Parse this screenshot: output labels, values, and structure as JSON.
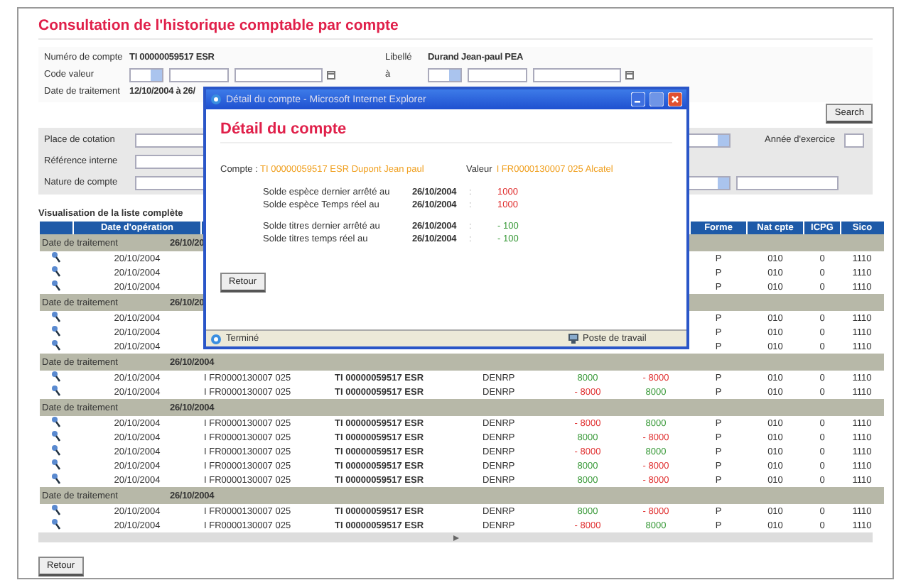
{
  "page_title": "Consultation de l'historique comptable par compte",
  "form": {
    "account_label": "Numéro de compte",
    "account_value": "TI 00000059517 ESR",
    "libelle_label": "Libellé",
    "libelle_value": "Durand Jean-paul PEA",
    "code_label": "Code valeur",
    "to_label": "à",
    "date_label": "Date de traitement",
    "date_value": "12/10/2004 à 26/"
  },
  "search_button": "Search",
  "filters": {
    "place_label": "Place de cotation",
    "ref_label": "Référence interne",
    "nature_label": "Nature de compte",
    "year_label": "Année d'exercice"
  },
  "list_caption": "Visualisation de la liste complète",
  "table": {
    "columns": {
      "date": "Date d'opération",
      "forme": "Forme",
      "nat": "Nat cpte",
      "icpg": "ICPG",
      "sico": "Sico"
    },
    "rows": [
      {
        "kind": "group",
        "label": "Date de traitement",
        "date": "26/10/20"
      },
      {
        "kind": "entry",
        "date": "20/10/2004",
        "forme": "P",
        "nat": "010",
        "icpg": "0",
        "sico": "1110"
      },
      {
        "kind": "entry",
        "date": "20/10/2004",
        "forme": "P",
        "nat": "010",
        "icpg": "0",
        "sico": "1110"
      },
      {
        "kind": "entry",
        "date": "20/10/2004",
        "forme": "P",
        "nat": "010",
        "icpg": "0",
        "sico": "1110"
      },
      {
        "kind": "group",
        "label": "Date de traitement",
        "date": "26/10/20"
      },
      {
        "kind": "entry",
        "date": "20/10/2004",
        "forme": "P",
        "nat": "010",
        "icpg": "0",
        "sico": "1110"
      },
      {
        "kind": "entry",
        "date": "20/10/2004",
        "forme": "P",
        "nat": "010",
        "icpg": "0",
        "sico": "1110"
      },
      {
        "kind": "entry",
        "date": "20/10/2004",
        "forme": "P",
        "nat": "010",
        "icpg": "0",
        "sico": "1110"
      },
      {
        "kind": "group",
        "label": "Date de traitement",
        "date": "26/10/2004"
      },
      {
        "kind": "entry",
        "date": "20/10/2004",
        "isin": "I FR0000130007 025",
        "account": "TI 00000059517 ESR",
        "operation": "DENRP",
        "amount_1": {
          "text": "8000",
          "color": "#3a9a3a"
        },
        "amount_2": {
          "text": "- 8000",
          "color": "#e03030"
        },
        "forme": "P",
        "nat": "010",
        "icpg": "0",
        "sico": "1110"
      },
      {
        "kind": "entry",
        "date": "20/10/2004",
        "isin": "I FR0000130007 025",
        "account": "TI 00000059517 ESR",
        "operation": "DENRP",
        "amount_1": {
          "text": "- 8000",
          "color": "#e03030"
        },
        "amount_2": {
          "text": "8000",
          "color": "#3a9a3a"
        },
        "forme": "P",
        "nat": "010",
        "icpg": "0",
        "sico": "1110"
      },
      {
        "kind": "group",
        "label": "Date de traitement",
        "date": "26/10/2004"
      },
      {
        "kind": "entry",
        "date": "20/10/2004",
        "isin": "I FR0000130007 025",
        "account": "TI 00000059517 ESR",
        "operation": "DENRP",
        "amount_1": {
          "text": "- 8000",
          "color": "#e03030"
        },
        "amount_2": {
          "text": "8000",
          "color": "#3a9a3a"
        },
        "forme": "P",
        "nat": "010",
        "icpg": "0",
        "sico": "1110"
      },
      {
        "kind": "entry",
        "date": "20/10/2004",
        "isin": "I FR0000130007 025",
        "account": "TI 00000059517 ESR",
        "operation": "DENRP",
        "amount_1": {
          "text": "8000",
          "color": "#3a9a3a"
        },
        "amount_2": {
          "text": "- 8000",
          "color": "#e03030"
        },
        "forme": "P",
        "nat": "010",
        "icpg": "0",
        "sico": "1110"
      },
      {
        "kind": "entry",
        "date": "20/10/2004",
        "isin": "I FR0000130007 025",
        "account": "TI 00000059517 ESR",
        "operation": "DENRP",
        "amount_1": {
          "text": "- 8000",
          "color": "#e03030"
        },
        "amount_2": {
          "text": "8000",
          "color": "#3a9a3a"
        },
        "forme": "P",
        "nat": "010",
        "icpg": "0",
        "sico": "1110"
      },
      {
        "kind": "entry",
        "date": "20/10/2004",
        "isin": "I FR0000130007 025",
        "account": "TI 00000059517 ESR",
        "operation": "DENRP",
        "amount_1": {
          "text": "8000",
          "color": "#3a9a3a"
        },
        "amount_2": {
          "text": "- 8000",
          "color": "#e03030"
        },
        "forme": "P",
        "nat": "010",
        "icpg": "0",
        "sico": "1110"
      },
      {
        "kind": "entry",
        "date": "20/10/2004",
        "isin": "I FR0000130007 025",
        "account": "TI 00000059517 ESR",
        "operation": "DENRP",
        "amount_1": {
          "text": "8000",
          "color": "#3a9a3a"
        },
        "amount_2": {
          "text": "- 8000",
          "color": "#e03030"
        },
        "forme": "P",
        "nat": "010",
        "icpg": "0",
        "sico": "1110"
      },
      {
        "kind": "group",
        "label": "Date de traitement",
        "date": "26/10/2004"
      },
      {
        "kind": "entry",
        "date": "20/10/2004",
        "isin": "I FR0000130007 025",
        "account": "TI 00000059517 ESR",
        "operation": "DENRP",
        "amount_1": {
          "text": "8000",
          "color": "#3a9a3a"
        },
        "amount_2": {
          "text": "- 8000",
          "color": "#e03030"
        },
        "forme": "P",
        "nat": "010",
        "icpg": "0",
        "sico": "1110"
      },
      {
        "kind": "entry",
        "date": "20/10/2004",
        "isin": "I FR0000130007 025",
        "account": "TI 00000059517 ESR",
        "operation": "DENRP",
        "amount_1": {
          "text": "- 8000",
          "color": "#e03030"
        },
        "amount_2": {
          "text": "8000",
          "color": "#3a9a3a"
        },
        "forme": "P",
        "nat": "010",
        "icpg": "0",
        "sico": "1110"
      }
    ]
  },
  "back_button": "Retour",
  "popup": {
    "window_title": "Détail du compte - Microsoft Internet Explorer",
    "heading": "Détail du compte",
    "account_label": "Compte :",
    "account_value": "TI 00000059517 ESR Dupont Jean paul",
    "security_label": "Valeur",
    "security_value": "I FR0000130007 025 Alcatel",
    "balances": [
      {
        "label": "Solde espèce dernier arrêté au",
        "date": "26/10/2004",
        "sep": ":",
        "value": {
          "text": "1000",
          "color": "#e03030"
        }
      },
      {
        "label": "Solde espèce Temps réel au",
        "date": "26/10/2004",
        "sep": ":",
        "value": {
          "text": "1000",
          "color": "#e03030"
        }
      },
      {
        "label": "Solde titres dernier arrêté au",
        "date": "26/10/2004",
        "sep": ":",
        "value": {
          "text": "- 100",
          "color": "#3a9a3a"
        }
      },
      {
        "label": "Solde titres temps réel au",
        "date": "26/10/2004",
        "sep": ":",
        "value": {
          "text": "- 100",
          "color": "#3a9a3a"
        }
      }
    ],
    "back_button": "Retour",
    "status_left": "Terminé",
    "status_right": "Poste de travail"
  }
}
